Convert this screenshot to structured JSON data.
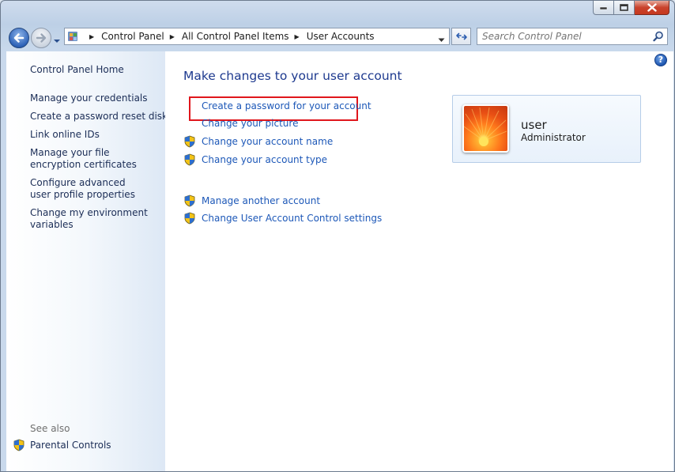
{
  "window": {
    "caption_buttons": [
      "minimize",
      "maximize",
      "close"
    ]
  },
  "navigation": {
    "breadcrumbs": [
      "Control Panel",
      "All Control Panel Items",
      "User Accounts"
    ],
    "search_placeholder": "Search Control Panel"
  },
  "left_nav": {
    "home_label": "Control Panel Home",
    "items": [
      {
        "label": "Manage your credentials"
      },
      {
        "label": "Create a password reset disk"
      },
      {
        "label": "Link online IDs"
      },
      {
        "label": "Manage your file encryption certificates"
      },
      {
        "label": "Configure advanced user profile properties"
      },
      {
        "label": "Change my environment variables"
      }
    ],
    "see_also_heading": "See also",
    "parental_controls": "Parental Controls"
  },
  "main": {
    "heading": "Make changes to your user account",
    "tasks": [
      {
        "label": "Create a password for your account",
        "shield": false
      },
      {
        "label": "Change your picture",
        "shield": false
      },
      {
        "label": "Change your account name",
        "shield": true
      },
      {
        "label": "Change your account type",
        "shield": true
      }
    ],
    "other_tasks": [
      {
        "label": "Manage another account",
        "shield": true
      },
      {
        "label": "Change User Account Control settings",
        "shield": true
      }
    ],
    "user": {
      "name": "user",
      "role": "Administrator"
    }
  },
  "colors": {
    "link": "#1d58b8",
    "heading": "#1e3a8f",
    "highlight": "#e0161c"
  }
}
